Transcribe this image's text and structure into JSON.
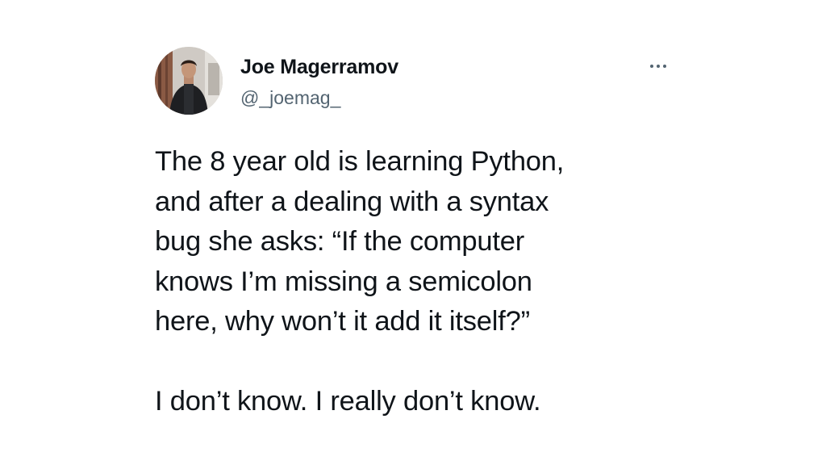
{
  "author": {
    "display_name": "Joe Magerramov",
    "handle": "@_joemag_",
    "avatar_icon": "profile-photo"
  },
  "more_icon": "ellipsis-icon",
  "tweet": {
    "paragraph1": [
      "The 8 year old is learning Python,",
      "and after a dealing with a syntax",
      "bug she asks: “If the computer",
      "knows I’m missing a semicolon",
      "here, why won’t it add it itself?”"
    ],
    "paragraph2": "I don’t know. I really don’t know."
  },
  "colors": {
    "text": "#0f1419",
    "secondary_text": "#536471",
    "background": "#ffffff"
  }
}
